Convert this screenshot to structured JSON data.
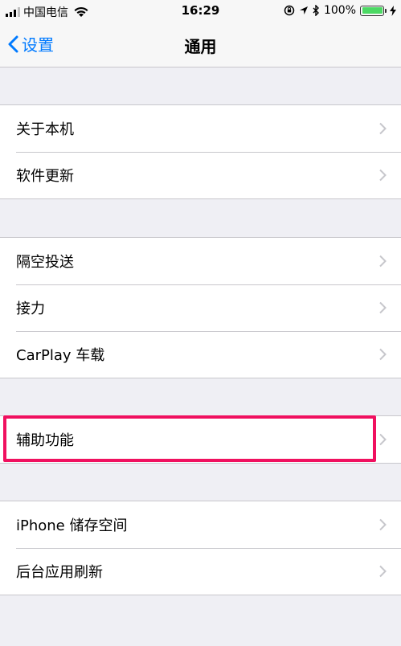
{
  "status_bar": {
    "carrier": "中国电信",
    "time": "16:29",
    "battery": "100%",
    "icons": [
      "signal-icon",
      "wifi-icon",
      "rotation-lock-icon",
      "location-icon",
      "bluetooth-icon",
      "battery-icon",
      "charging-icon"
    ]
  },
  "nav": {
    "back_label": "设置",
    "title": "通用"
  },
  "groups": [
    {
      "items": [
        {
          "label": "关于本机"
        },
        {
          "label": "软件更新"
        }
      ]
    },
    {
      "items": [
        {
          "label": "隔空投送"
        },
        {
          "label": "接力"
        },
        {
          "label": "CarPlay 车载"
        }
      ]
    },
    {
      "items": [
        {
          "label": "辅助功能"
        }
      ]
    },
    {
      "items": [
        {
          "label": "iPhone 储存空间"
        },
        {
          "label": "后台应用刷新"
        }
      ]
    }
  ],
  "colors": {
    "accent": "#007aff",
    "highlight": "#f0105f",
    "battery": "#4cd964",
    "background": "#efeff4"
  }
}
